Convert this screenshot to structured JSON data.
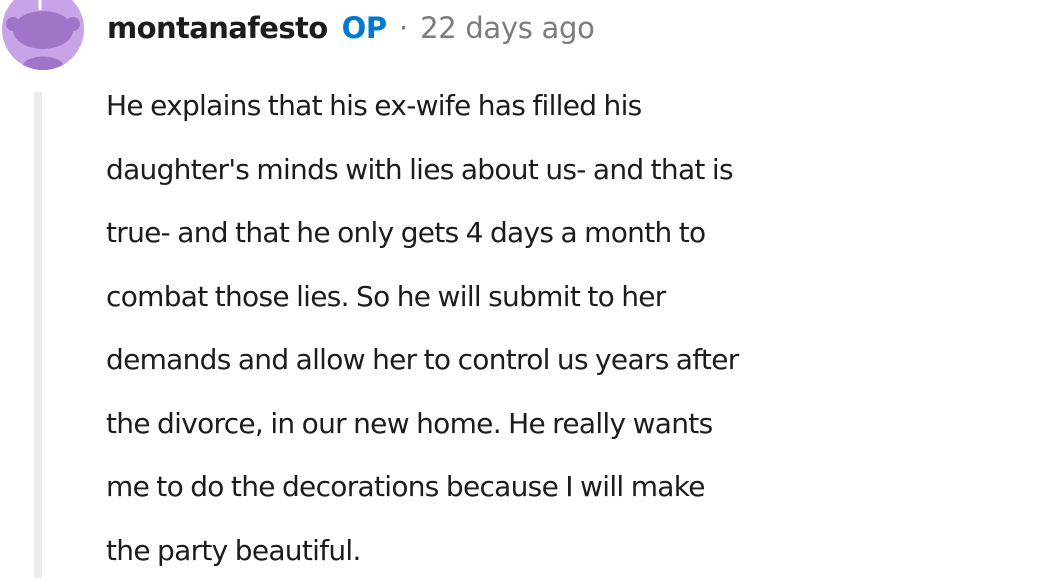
{
  "comment": {
    "author": "montanafesto",
    "op_badge": "OP",
    "separator": "·",
    "timestamp": "22 days ago",
    "avatar_icon": "reddit-snoo-avatar-icon",
    "avatar_color": "#c8a3e8",
    "body_lines": [
      "He explains that his ex-wife has filled his",
      "daughter's minds with lies about us- and that is",
      "true- and that he only gets 4 days a month to",
      "combat those lies. So he will submit to her",
      "demands and allow her to control us years after",
      "the divorce, in our new home. He really wants",
      "me to do the decorations because I will make",
      "the party beautiful."
    ]
  },
  "colors": {
    "op_accent": "#0079d3",
    "text": "#1c1c1c",
    "muted": "#7c7c7c",
    "thread_line": "#ececec"
  }
}
